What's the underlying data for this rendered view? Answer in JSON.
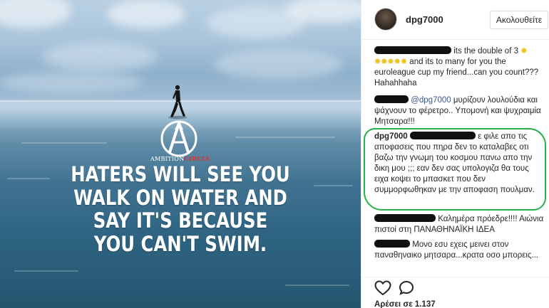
{
  "post": {
    "image": {
      "quote": "HATERS WILL SEE YOU\nWALK ON WATER AND\nSAY IT'S BECAUSE\nYOU CAN'T SWIM.",
      "logo_text_main": "AMBITION",
      "logo_text_accent": "CIRCLE",
      "logo_accent_color": "#e0312f"
    },
    "author": {
      "username": "dpg7000",
      "follow_label": "Ακολουθείτε"
    },
    "comments": [
      {
        "text_a": "its the double of 3",
        "text_b": "and its to many for you the euroleague cup my friend...can you count??? Hahahhaha"
      },
      {
        "mention": "@dpg7000",
        "text": "μυρίζουν λουλούδια και ψάχνουν το φέρετρο.. Υπομονή και ψυχραιμία Μητσαρα!!!"
      },
      {
        "username": "dpg7000",
        "text": "ε φιλε απο τις αποφασεις που πηρα δεν το καταλαβες οτι βαζω την γνωμη του κοσμου πανω απο την δικη μου ;;; εαν δεν σας υπολογιζα θα τους ειχα κοψει το μπασκετ που δεν συμμορφωθηκαν με την αποφαση πουλμαν."
      },
      {
        "text": "Καλημέρα πρόεδρε!!!! Αιώνια πιστοί στη ΠΑΝΑΘΗΝΑΪΚΗ ΙΔΕΑ"
      },
      {
        "text": "Μονο εσυ εχεις μεινει στον παναθηναικο μητσαρα...κρατα οσο μπορεις..."
      }
    ],
    "actions": {
      "like_icon": "heart-icon",
      "comment_icon": "speech-bubble-icon",
      "likes_text": "Αρέσει σε 1.137"
    },
    "highlight_color": "#25b24a"
  }
}
